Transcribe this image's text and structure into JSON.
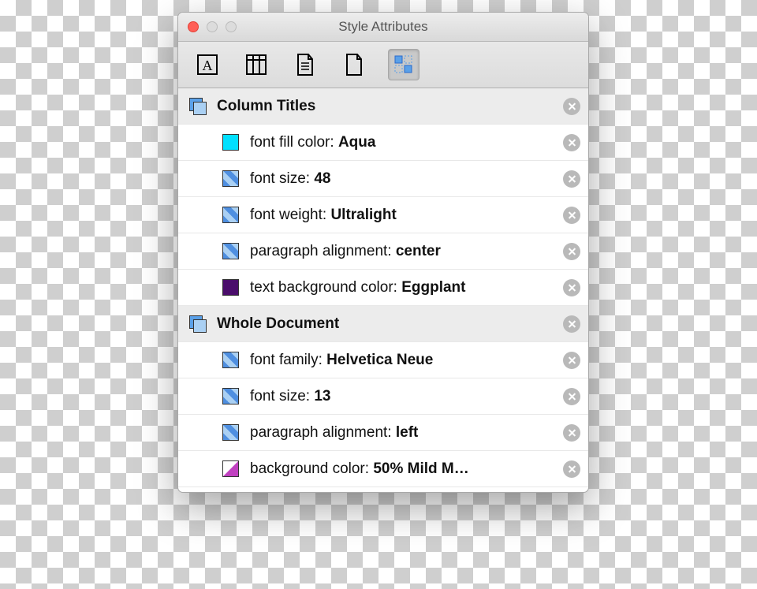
{
  "window": {
    "title": "Style Attributes"
  },
  "sections": [
    {
      "title": "Column Titles",
      "attrs": [
        {
          "swatch": "aqua",
          "label": "font fill color: ",
          "value": "Aqua"
        },
        {
          "swatch": "blue",
          "label": "font size: ",
          "value": "48"
        },
        {
          "swatch": "blue",
          "label": "font weight: ",
          "value": "Ultralight"
        },
        {
          "swatch": "blue",
          "label": "paragraph alignment: ",
          "value": "center"
        },
        {
          "swatch": "eggplant",
          "label": "text background color: ",
          "value": "Eggplant"
        }
      ]
    },
    {
      "title": "Whole Document",
      "attrs": [
        {
          "swatch": "blue",
          "label": "font family: ",
          "value": "Helvetica Neue"
        },
        {
          "swatch": "blue",
          "label": "font size: ",
          "value": "13"
        },
        {
          "swatch": "blue",
          "label": "paragraph alignment: ",
          "value": "left"
        },
        {
          "swatch": "magenta",
          "label": "background color: ",
          "value": "50% Mild M…"
        }
      ]
    }
  ]
}
